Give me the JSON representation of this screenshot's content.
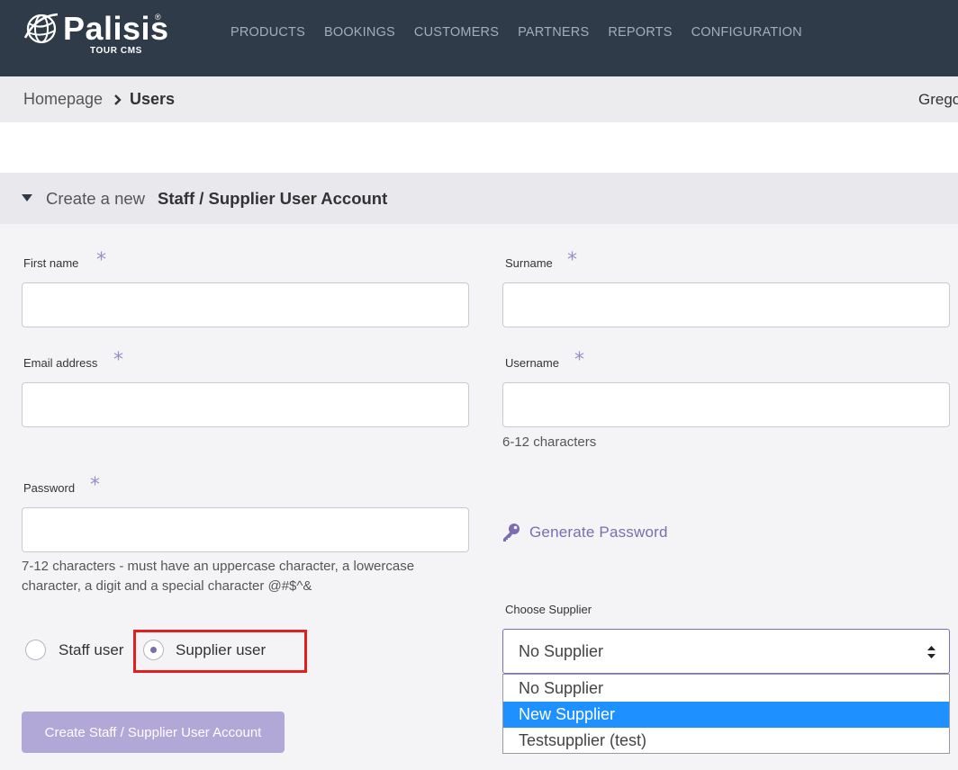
{
  "brand": {
    "name": "Palisis",
    "subtitle": "TOUR CMS",
    "registered_mark": "®"
  },
  "nav": {
    "items": [
      {
        "label": "PRODUCTS"
      },
      {
        "label": "BOOKINGS"
      },
      {
        "label": "CUSTOMERS"
      },
      {
        "label": "PARTNERS"
      },
      {
        "label": "REPORTS"
      },
      {
        "label": "CONFIGURATION"
      }
    ]
  },
  "breadcrumb": {
    "home": "Homepage",
    "current": "Users",
    "user_name": "Grego"
  },
  "section": {
    "prefix": "Create a new",
    "title": "Staff / Supplier User Account"
  },
  "form": {
    "first_name": {
      "label": "First name",
      "value": ""
    },
    "surname": {
      "label": "Surname",
      "value": ""
    },
    "email": {
      "label": "Email address",
      "value": ""
    },
    "username": {
      "label": "Username",
      "value": "",
      "hint": "6-12 characters"
    },
    "password": {
      "label": "Password",
      "value": "",
      "hint_line1": "7-12 characters - must have an uppercase character, a lowercase",
      "hint_line2": "character, a digit and a special character @#$^&"
    },
    "required_mark": "*",
    "generate_password": "Generate Password",
    "user_type": {
      "options": [
        {
          "label": "Staff user",
          "selected": false
        },
        {
          "label": "Supplier user",
          "selected": true
        }
      ]
    },
    "supplier": {
      "label": "Choose Supplier",
      "selected": "No Supplier",
      "options": [
        {
          "label": "No Supplier",
          "highlighted": false
        },
        {
          "label": "New Supplier",
          "highlighted": true
        },
        {
          "label": "Testsupplier (test)",
          "highlighted": false
        }
      ]
    },
    "submit_label": "Create Staff / Supplier User Account"
  },
  "colors": {
    "topbar": "#2f3b49",
    "accent": "#7b6db0",
    "required": "#9b8ec9",
    "highlight_box": "#e02020",
    "option_highlight": "#1e90ff",
    "submit_bg": "#b1a8d8"
  },
  "icons": {
    "logo": "globe-icon",
    "breadcrumb_sep": "chevron-right-icon",
    "section_toggle": "caret-down-icon",
    "generate_password": "key-icon",
    "select": "sort-arrows-icon"
  }
}
